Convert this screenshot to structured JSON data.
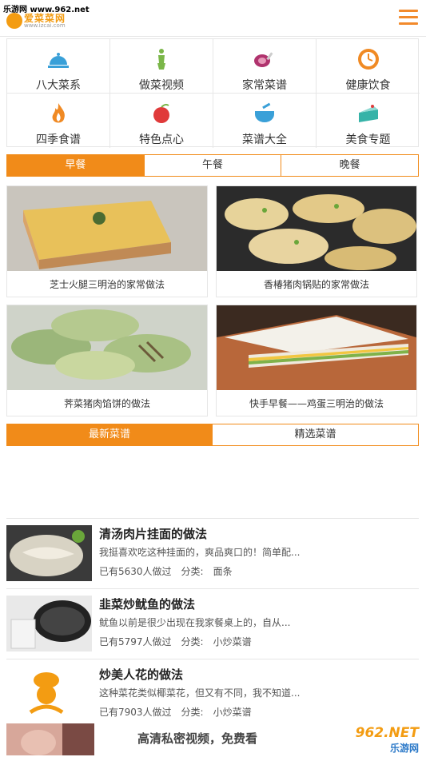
{
  "watermark": "乐游网 www.962.net",
  "logo": {
    "name": "爱菜菜网",
    "url": "www.izcai.com"
  },
  "categories": [
    {
      "label": "八大菜系",
      "icon": "cloche-icon",
      "color": "#3aa0d8"
    },
    {
      "label": "做菜视频",
      "icon": "chef-figure-icon",
      "color": "#7ab648"
    },
    {
      "label": "家常菜谱",
      "icon": "ham-leg-icon",
      "color": "#b0336e"
    },
    {
      "label": "健康饮食",
      "icon": "clock-icon",
      "color": "#f08a24"
    },
    {
      "label": "四季食谱",
      "icon": "flame-icon",
      "color": "#f08a24"
    },
    {
      "label": "特色点心",
      "icon": "apple-icon",
      "color": "#e03a3a"
    },
    {
      "label": "菜谱大全",
      "icon": "pot-icon",
      "color": "#3aa0d8"
    },
    {
      "label": "美食专题",
      "icon": "cake-slice-icon",
      "color": "#36b3a8"
    }
  ],
  "meal_tabs": [
    {
      "label": "早餐",
      "active": true
    },
    {
      "label": "午餐",
      "active": false
    },
    {
      "label": "晚餐",
      "active": false
    }
  ],
  "featured": [
    {
      "caption": "芝士火腿三明治的家常做法"
    },
    {
      "caption": "香椿猪肉锅贴的家常做法"
    },
    {
      "caption": "荠菜猪肉馅饼的做法"
    },
    {
      "caption": "快手早餐——鸡蛋三明治的做法"
    }
  ],
  "list_tabs": [
    {
      "label": "最新菜谱",
      "active": true
    },
    {
      "label": "精选菜谱",
      "active": false
    }
  ],
  "recipes": [
    {
      "title": "清汤肉片挂面的做法",
      "desc": "我挺喜欢吃这种挂面的，爽品爽口的！简单配...",
      "meta": "已有5630人做过　分类:　面条"
    },
    {
      "title": "韭菜炒鱿鱼的做法",
      "desc": "鱿鱼以前是很少出现在我家餐桌上的，自从...",
      "meta": "已有5797人做过　分类:　小炒菜谱"
    },
    {
      "title": "炒美人花的做法",
      "desc": "这种菜花类似椰菜花，但又有不同，我不知道...",
      "meta": "已有7903人做过　分类:　小炒菜谱"
    }
  ],
  "ad": {
    "text": "高清私密视频，免费看",
    "brand": "962.NET",
    "brand_sub": "乐游网"
  }
}
